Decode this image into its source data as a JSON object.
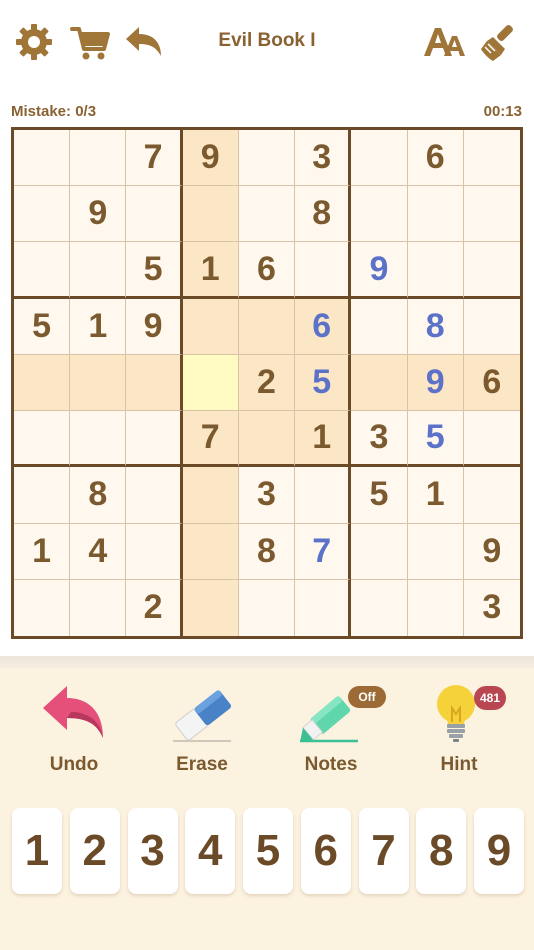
{
  "header": {
    "title": "Evil Book I",
    "icons": [
      "gear-icon",
      "cart-icon",
      "back-icon",
      "font-size-icon",
      "theme-brush-icon"
    ]
  },
  "status": {
    "mistakes": "Mistake: 0/3",
    "timer": "00:13"
  },
  "board": {
    "rows": [
      [
        "",
        "",
        "7",
        "9",
        "",
        "3",
        "",
        "6",
        ""
      ],
      [
        "",
        "9",
        "",
        "",
        "",
        "8",
        "",
        "",
        ""
      ],
      [
        "",
        "",
        "5",
        "1",
        "6",
        "",
        "9",
        "",
        ""
      ],
      [
        "5",
        "1",
        "9",
        "",
        "",
        "6",
        "",
        "8",
        ""
      ],
      [
        "",
        "",
        "",
        "",
        "2",
        "5",
        "",
        "9",
        "6"
      ],
      [
        "",
        "",
        "",
        "7",
        "",
        "1",
        "3",
        "5",
        ""
      ],
      [
        "",
        "8",
        "",
        "",
        "3",
        "",
        "5",
        "1",
        ""
      ],
      [
        "1",
        "4",
        "",
        "",
        "8",
        "7",
        "",
        "",
        "9"
      ],
      [
        "",
        "",
        "2",
        "",
        "",
        "",
        "",
        "",
        "3"
      ]
    ],
    "user_entries": [
      [
        2,
        6
      ],
      [
        3,
        5
      ],
      [
        3,
        7
      ],
      [
        4,
        5
      ],
      [
        4,
        7
      ],
      [
        5,
        7
      ],
      [
        7,
        5
      ]
    ],
    "selected": [
      4,
      3
    ]
  },
  "tools": {
    "undo": "Undo",
    "erase": "Erase",
    "notes": "Notes",
    "notes_state": "Off",
    "hint": "Hint",
    "hint_count": "481"
  },
  "numpad": [
    "1",
    "2",
    "3",
    "4",
    "5",
    "6",
    "7",
    "8",
    "9"
  ],
  "colors": {
    "brown": "#7a5a2e",
    "user_blue": "#5b72c8",
    "highlight": "#fbe6c5",
    "selected": "#fffbc2",
    "panel": "#fcf2e0"
  }
}
